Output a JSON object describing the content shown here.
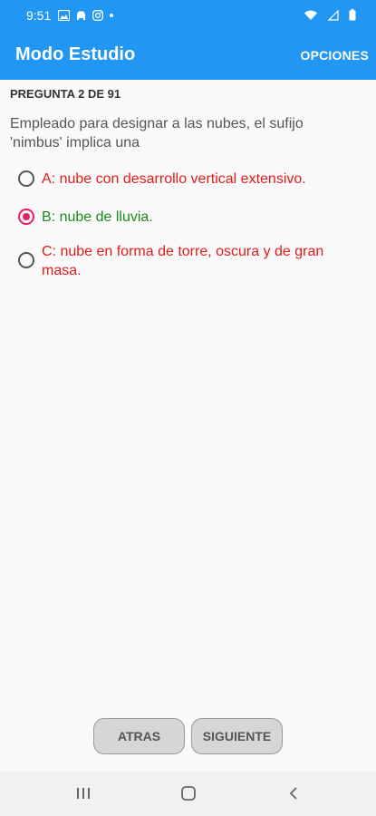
{
  "status_bar": {
    "time": "9:51"
  },
  "app_bar": {
    "title": "Modo Estudio",
    "options_label": "OPCIONES"
  },
  "quiz": {
    "counter": "PREGUNTA 2 DE 91",
    "question": "Empleado para designar a las nubes, el sufijo 'nimbus' implica una",
    "options": [
      {
        "label": "A: nube con desarrollo vertical extensivo.",
        "selected": false,
        "color": "#e21b1b"
      },
      {
        "label": "B: nube de lluvia.",
        "selected": true,
        "color": "#1b8a1b"
      },
      {
        "label": "C: nube en forma de torre, oscura y de gran masa.",
        "selected": false,
        "color": "#e21b1b"
      }
    ]
  },
  "buttons": {
    "back_label": "ATRAS",
    "next_label": "SIGUIENTE"
  },
  "colors": {
    "primary": "#2196f3",
    "radio_selected": "#e91e63",
    "wrong": "#e21b1b",
    "correct": "#1b8a1b"
  },
  "icons": {
    "status_left": [
      "image-icon",
      "car-icon",
      "instagram-icon",
      "dot-icon"
    ],
    "status_right": [
      "wifi-icon",
      "signal-icon",
      "battery-icon"
    ],
    "nav": [
      "recent-apps-icon",
      "home-icon",
      "back-icon"
    ]
  }
}
